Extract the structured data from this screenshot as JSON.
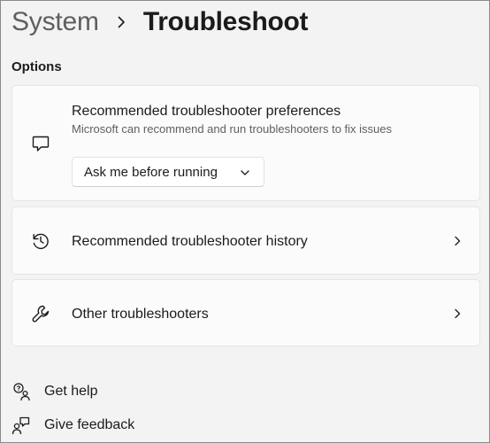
{
  "breadcrumb": {
    "parent": "System",
    "current": "Troubleshoot"
  },
  "section": {
    "title": "Options"
  },
  "cards": {
    "preferences": {
      "icon": "chat-bubble-icon",
      "title": "Recommended troubleshooter preferences",
      "description": "Microsoft can recommend and run troubleshooters to fix issues",
      "dropdown_value": "Ask me before running"
    },
    "history": {
      "icon": "history-clock-icon",
      "title": "Recommended troubleshooter history"
    },
    "other": {
      "icon": "wrench-icon",
      "title": "Other troubleshooters"
    }
  },
  "footer": {
    "get_help": "Get help",
    "give_feedback": "Give feedback"
  },
  "colors": {
    "background": "#f3f3f3",
    "card": "#fbfbfb",
    "text": "#1b1b1b",
    "secondary_text": "#5f5f5f"
  }
}
